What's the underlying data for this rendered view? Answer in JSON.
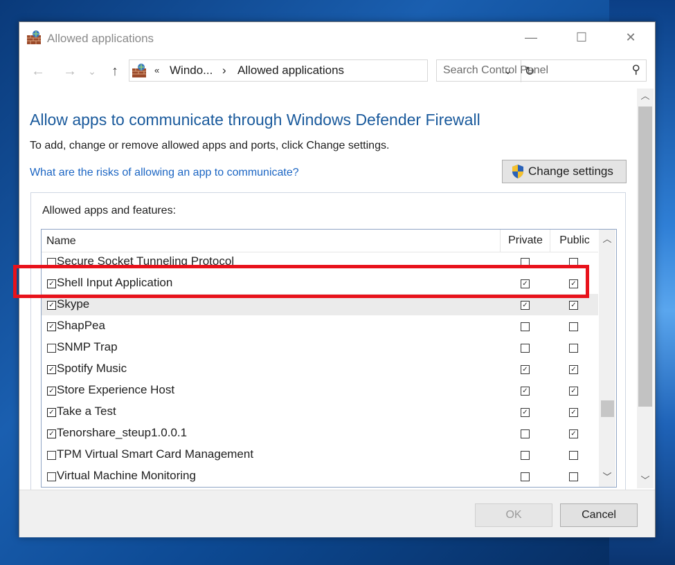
{
  "window": {
    "title": "Allowed applications",
    "minimize_glyph": "—",
    "maximize_glyph": "☐",
    "close_glyph": "✕"
  },
  "nav": {
    "back_glyph": "←",
    "forward_glyph": "→",
    "recent_glyph": "⌄",
    "up_glyph": "↑",
    "address_chevrons": "«",
    "breadcrumb_1": "Windo...",
    "breadcrumb_sep": "›",
    "breadcrumb_2": "Allowed applications",
    "dropdown_glyph": "⌄",
    "refresh_glyph": "↻",
    "search_placeholder": "Search Control Panel",
    "search_glyph": "⚲"
  },
  "content": {
    "heading": "Allow apps to communicate through Windows Defender Firewall",
    "description": "To add, change or remove allowed apps and ports, click Change settings.",
    "risk_link": "What are the risks of allowing an app to communicate?",
    "change_settings_label": "Change settings",
    "group_label": "Allowed apps and features:",
    "columns": {
      "name": "Name",
      "private": "Private",
      "public": "Public"
    },
    "rows": [
      {
        "name": "Secure Socket Tunneling Protocol",
        "enabled": false,
        "private": false,
        "public": false
      },
      {
        "name": "Shell Input Application",
        "enabled": true,
        "private": true,
        "public": true
      },
      {
        "name": "Skype",
        "enabled": true,
        "private": true,
        "public": true
      },
      {
        "name": "ShapPea",
        "enabled": true,
        "private": false,
        "public": false
      },
      {
        "name": "SNMP Trap",
        "enabled": false,
        "private": false,
        "public": false
      },
      {
        "name": "Spotify Music",
        "enabled": true,
        "private": true,
        "public": true
      },
      {
        "name": "Store Experience Host",
        "enabled": true,
        "private": true,
        "public": true
      },
      {
        "name": "Take a Test",
        "enabled": true,
        "private": true,
        "public": true
      },
      {
        "name": "Tenorshare_steup1.0.0.1",
        "enabled": true,
        "private": false,
        "public": true
      },
      {
        "name": "TPM Virtual Smart Card Management",
        "enabled": false,
        "private": false,
        "public": false
      },
      {
        "name": "Virtual Machine Monitoring",
        "enabled": false,
        "private": false,
        "public": false
      }
    ],
    "selected_row": "Skype"
  },
  "footer": {
    "ok_label": "OK",
    "cancel_label": "Cancel"
  },
  "colors": {
    "heading": "#1a5a9c",
    "link": "#1b65c3",
    "highlight_box": "#e8121b"
  },
  "icons": {
    "app": "firewall-bricks-icon",
    "shield": "uac-shield-icon"
  }
}
